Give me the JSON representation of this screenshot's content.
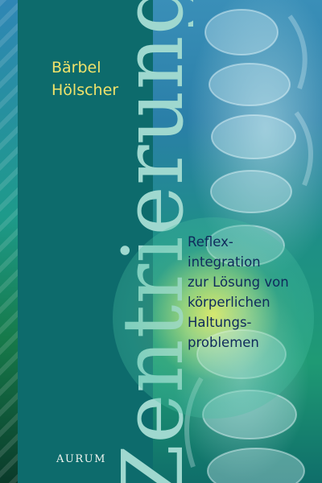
{
  "book": {
    "author_lines": [
      "Bärbel",
      "Hölscher"
    ],
    "title": "Zentrierung",
    "subtitle_lines": [
      "Reflex-",
      "integration",
      "zur Lösung von",
      "körperlichen",
      "Haltungs-",
      "problemen"
    ],
    "publisher": "AURUM"
  },
  "colors": {
    "panel": "#0d6b6c",
    "title": "#9fd8cf",
    "author": "#f1e36a",
    "subtitle": "#0f2a5c",
    "publisher": "#f2f6f0"
  }
}
